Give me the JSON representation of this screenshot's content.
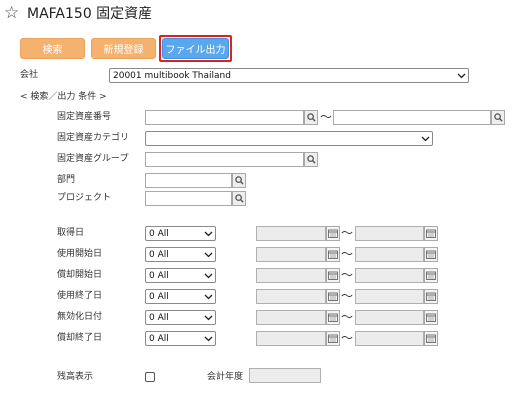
{
  "header": {
    "star_icon": "star-outline-icon",
    "title": "MAFA150 固定資産"
  },
  "toolbar": {
    "search_label": "検索",
    "new_label": "新規登録",
    "export_label": "ファイル出力"
  },
  "company": {
    "label": "会社",
    "value": "20001 multibook Thailand"
  },
  "section": {
    "label": "< 検索／出力 条件 >"
  },
  "fields": {
    "asset_no": "固定資産番号",
    "asset_category": "固定資産カテゴリ",
    "asset_group": "固定資産グループ",
    "department": "部門",
    "project": "プロジェクト"
  },
  "date_rows": [
    {
      "label": "取得日",
      "value": "0 All"
    },
    {
      "label": "使用開始日",
      "value": "0 All"
    },
    {
      "label": "償却開始日",
      "value": "0 All"
    },
    {
      "label": "使用終了日",
      "value": "0 All"
    },
    {
      "label": "無効化日付",
      "value": "0 All"
    },
    {
      "label": "償却終了日",
      "value": "0 All"
    }
  ],
  "tilde": "〜",
  "balance": {
    "label": "残高表示",
    "fiscal_year_label": "会計年度"
  },
  "colors": {
    "orange": "#f4b26e",
    "blue": "#5aa7ec",
    "highlight": "#e02020"
  }
}
